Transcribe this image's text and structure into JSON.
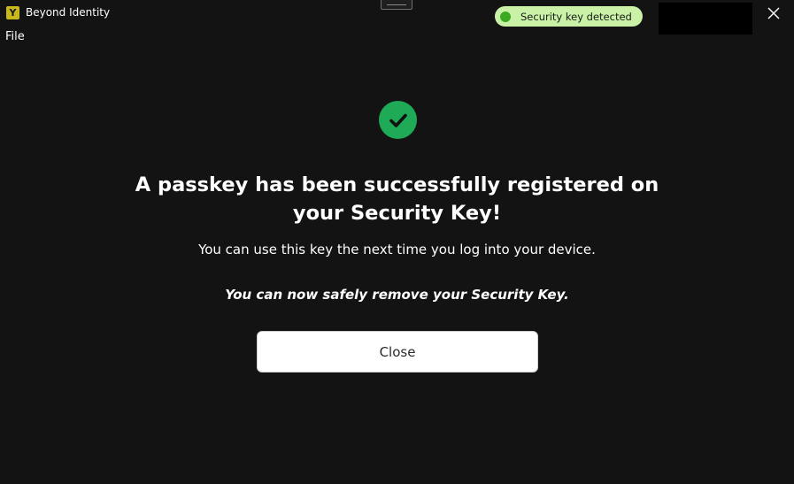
{
  "titlebar": {
    "app_name": "Beyond Identity",
    "logo_icon": "beyond-identity-logo",
    "logo_glyph": "Y",
    "logo_color": "#c9b81c",
    "status_text": "Security key detected",
    "status_color": "#c9f2a7",
    "status_dot_color": "#3aaa22",
    "close_icon": "close-icon"
  },
  "menu": {
    "items": [
      {
        "label": "File"
      }
    ]
  },
  "content": {
    "success_icon": "checkmark-circle-icon",
    "success_color": "#1faa57",
    "heading_line1": "A passkey has been successfully registered on",
    "heading_line2": "your Security Key!",
    "subtitle": "You can use this key the next time you log into your device.",
    "note": "You can now safely remove your Security Key.",
    "close_button_label": "Close"
  }
}
